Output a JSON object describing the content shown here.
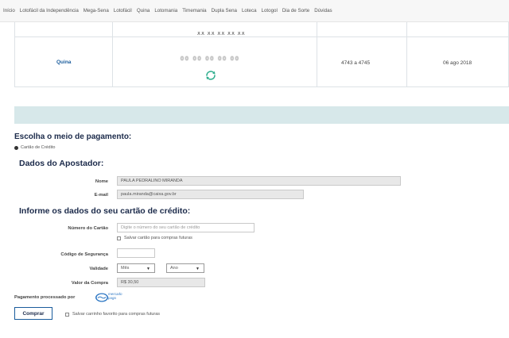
{
  "nav": [
    "Início",
    "Lotofácil da Independência",
    "Mega-Sena",
    "Lotofácil",
    "Quina",
    "Lotomania",
    "Timemania",
    "Dupla Sena",
    "Loteca",
    "Lotogol",
    "Dia de Sorte",
    "Dúvidas"
  ],
  "bet": {
    "clipped_numbers": "XX XX XX XX XX",
    "lottery": "Quina",
    "numbers": "00 00 00 00 00",
    "concurso": "4743 a 4745",
    "date": "06 ago 2018"
  },
  "payment": {
    "heading": "Escolha o meio de pagamento:",
    "option": "Cartão de Crédito"
  },
  "apostador": {
    "heading": "Dados do Apostador:",
    "nome_label": "Nome",
    "nome_value": "PAULA PEDRALINO MIRANDA",
    "email_label": "E-mail",
    "email_value": "paula.miranda@caixa.gov.br"
  },
  "cartao": {
    "heading": "Informe os dados do seu cartão de crédito:",
    "numero_label": "Número do Cartão",
    "numero_placeholder": "Digite o número do seu cartão de crédito",
    "salvar_cartao": "Salvar cartão para compras futuras",
    "codigo_label": "Código de Segurança",
    "validade_label": "Validade",
    "mes": "Mês",
    "ano": "Ano",
    "valor_label": "Valor da Compra",
    "valor": "R$ 30,50",
    "processado_label": "Pagamento processado por",
    "mp_line1": "mercado",
    "mp_line2": "pago"
  },
  "footer": {
    "comprar": "Comprar",
    "salvar_carrinho": "Salvar carrinho favorito para compras futuras"
  },
  "colors": {
    "band": "#d7e8ea",
    "heading": "#1b2a4a",
    "link": "#1a5c9c",
    "refresh": "#2fae8e"
  }
}
